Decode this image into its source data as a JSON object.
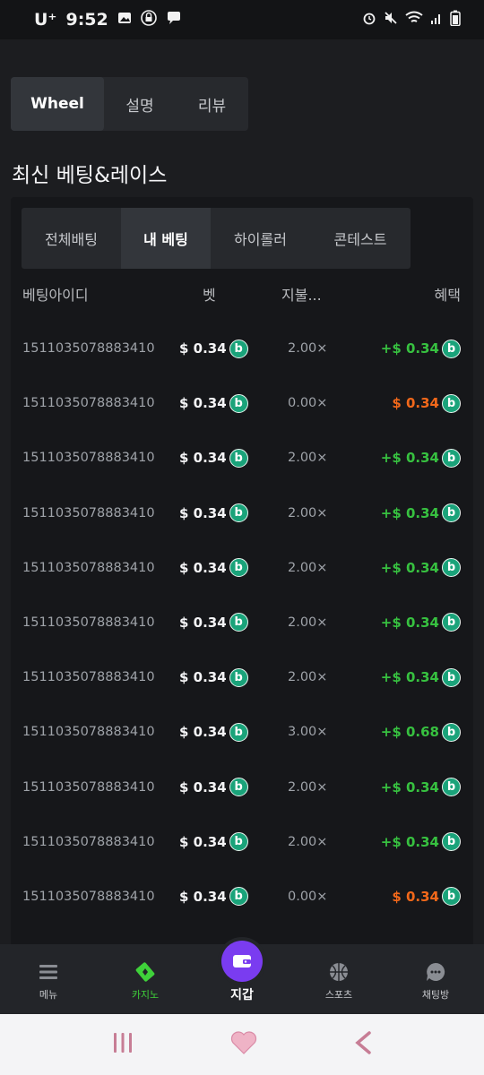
{
  "status_bar": {
    "carrier": "U⁺",
    "time": "9:52",
    "left_icons": [
      "gallery-icon",
      "lock-icon",
      "chat-icon"
    ],
    "right_icons": [
      "alarm-icon",
      "mute-icon",
      "wifi-icon",
      "signal-icon",
      "battery-icon"
    ]
  },
  "game_tabs": [
    {
      "label": "Wheel",
      "active": true
    },
    {
      "label": "설명",
      "active": false
    },
    {
      "label": "리뷰",
      "active": false
    }
  ],
  "section_title": "최신 베팅&레이스",
  "bet_tabs": [
    {
      "label": "전체배팅",
      "active": false
    },
    {
      "label": "내 베팅",
      "active": true
    },
    {
      "label": "하이롤러",
      "active": false
    },
    {
      "label": "콘테스트",
      "active": false
    }
  ],
  "table": {
    "headers": {
      "id": "베팅아이디",
      "bet": "벳",
      "payout": "지불...",
      "profit": "혜택"
    },
    "rows": [
      {
        "id": "1511035078883410",
        "bet": "$ 0.34",
        "payout": "2.00×",
        "profit": "+$ 0.34",
        "win": true
      },
      {
        "id": "1511035078883410",
        "bet": "$ 0.34",
        "payout": "0.00×",
        "profit": "$ 0.34",
        "win": false
      },
      {
        "id": "1511035078883410",
        "bet": "$ 0.34",
        "payout": "2.00×",
        "profit": "+$ 0.34",
        "win": true
      },
      {
        "id": "1511035078883410",
        "bet": "$ 0.34",
        "payout": "2.00×",
        "profit": "+$ 0.34",
        "win": true
      },
      {
        "id": "1511035078883410",
        "bet": "$ 0.34",
        "payout": "2.00×",
        "profit": "+$ 0.34",
        "win": true
      },
      {
        "id": "1511035078883410",
        "bet": "$ 0.34",
        "payout": "2.00×",
        "profit": "+$ 0.34",
        "win": true
      },
      {
        "id": "1511035078883410",
        "bet": "$ 0.34",
        "payout": "2.00×",
        "profit": "+$ 0.34",
        "win": true
      },
      {
        "id": "1511035078883410",
        "bet": "$ 0.34",
        "payout": "3.00×",
        "profit": "+$ 0.68",
        "win": true
      },
      {
        "id": "1511035078883410",
        "bet": "$ 0.34",
        "payout": "2.00×",
        "profit": "+$ 0.34",
        "win": true
      },
      {
        "id": "1511035078883410",
        "bet": "$ 0.34",
        "payout": "2.00×",
        "profit": "+$ 0.34",
        "win": true
      },
      {
        "id": "1511035078883410",
        "bet": "$ 0.34",
        "payout": "0.00×",
        "profit": "$ 0.34",
        "win": false
      }
    ]
  },
  "coin_icon": "b",
  "bottom_nav": {
    "menu": "메뉴",
    "casino": "카지노",
    "wallet": "지갑",
    "sports": "스포츠",
    "chat": "채팅방"
  },
  "colors": {
    "win": "#37c140",
    "loss": "#f2681a",
    "casino_active": "#3fd13a",
    "wallet_button": "#7a3cf0",
    "coin": "#1aa37a"
  }
}
